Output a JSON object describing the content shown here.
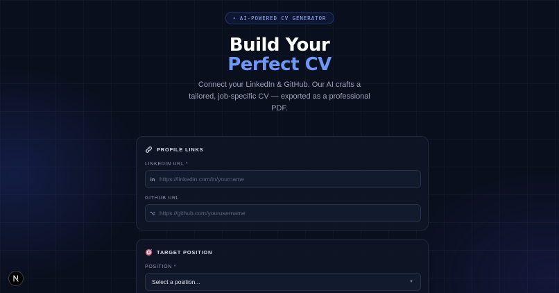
{
  "hero": {
    "badge": "AI-POWERED CV GENERATOR",
    "title_line1": "Build Your",
    "title_line2": "Perfect CV",
    "subtitle": "Connect your LinkedIn & GitHub. Our AI crafts a tailored, job-specific CV — exported as a professional PDF."
  },
  "profile_links": {
    "heading": "PROFILE LINKS",
    "linkedin": {
      "label": "LINKEDIN URL *",
      "prefix": "in",
      "placeholder": "https://linkedin.com/in/yourname",
      "value": ""
    },
    "github": {
      "label": "GITHUB URL",
      "prefix": "⌥",
      "placeholder": "https://github.com/yourusername",
      "value": ""
    }
  },
  "target_position": {
    "heading": "TARGET POSITION",
    "position_label": "POSITION *",
    "position_selected": "Select a position..."
  },
  "colors": {
    "background": "#0a0f1e",
    "accent": "#6f97f5",
    "card": "#0f1526",
    "border": "#1d2740"
  },
  "icons": {
    "badge": "sparkle-icon",
    "profile_links": "link-icon",
    "target_position": "target-icon",
    "framework": "nextjs-logo-icon"
  }
}
